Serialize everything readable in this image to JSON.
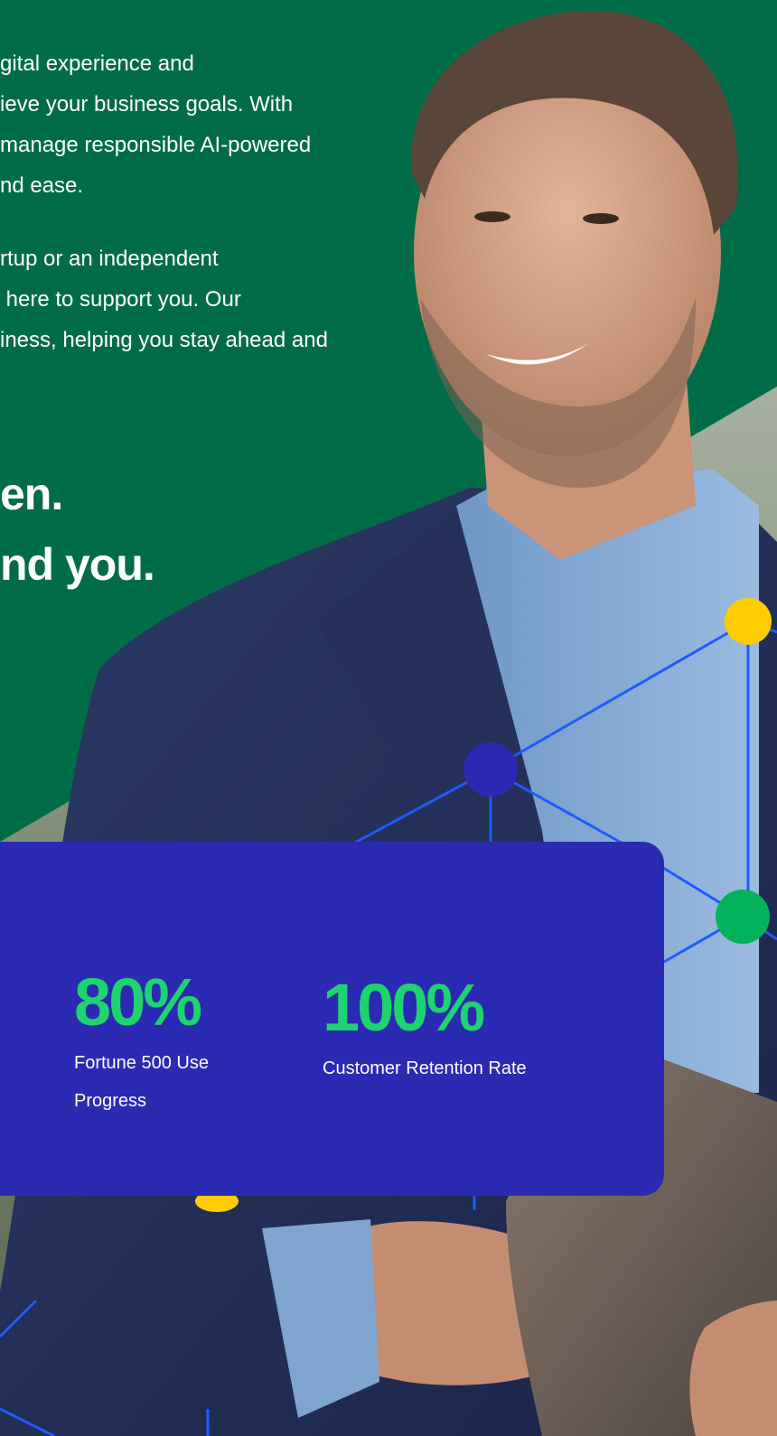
{
  "intro": {
    "paragraph1": [
      "gital experience and",
      "ieve your business goals. With",
      "manage responsible AI-powered",
      "nd ease."
    ],
    "paragraph2": [
      "rtup or an independent",
      " here to support you. Our",
      "iness, helping you stay ahead and"
    ]
  },
  "headline": {
    "line1": "en.",
    "line2": "nd you."
  },
  "stats": [
    {
      "value": "80%",
      "label": "Fortune 500 Use Progress"
    },
    {
      "value": "100%",
      "label": "Customer Retention Rate"
    }
  ],
  "colors": {
    "brand_green": "#006c47",
    "card_blue": "#2b2ab3",
    "stat_green": "#1fd36f",
    "node_yellow": "#ffcc00",
    "node_green": "#00b25a",
    "network_line": "#1f5cff"
  }
}
